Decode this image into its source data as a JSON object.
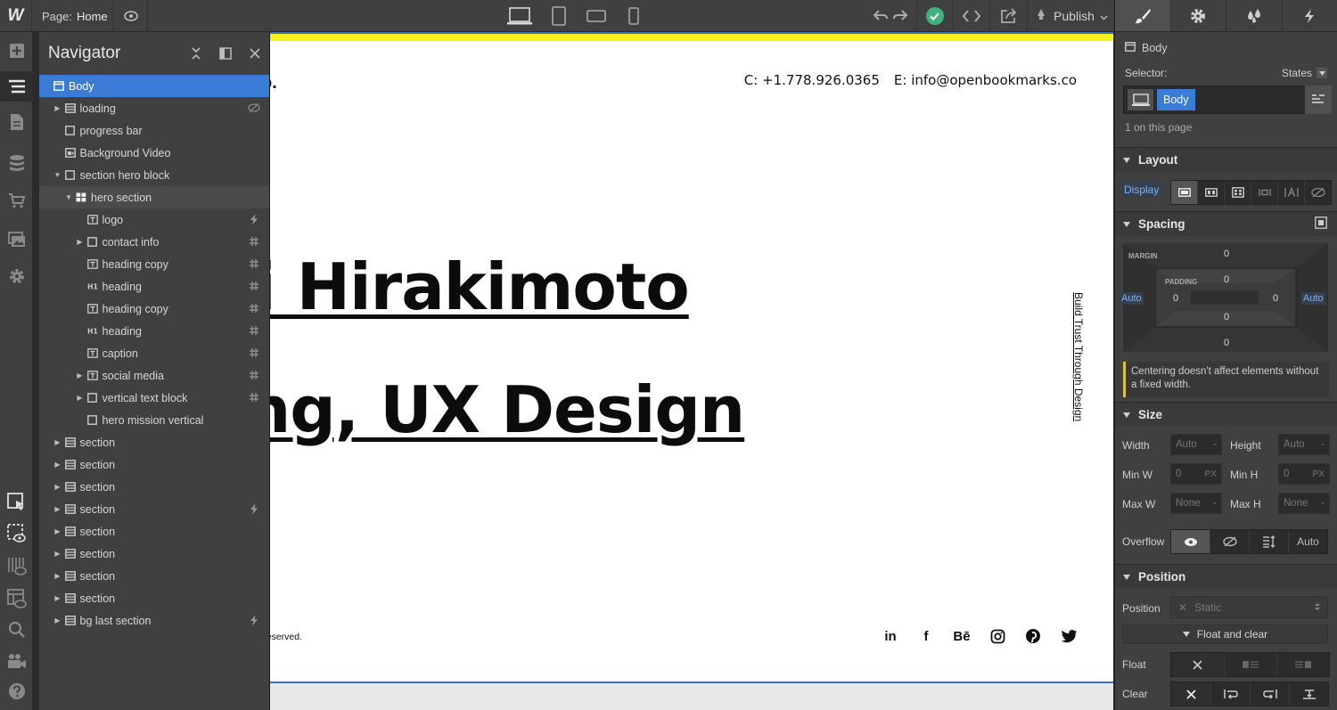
{
  "topbar": {
    "logo": "W",
    "page_label": "Page:",
    "page_name": "Home",
    "publish_label": "Publish"
  },
  "navigator": {
    "title": "Navigator",
    "items": [
      {
        "label": "Body",
        "depth": 0,
        "caret": "",
        "icon": "body",
        "right": "",
        "selected": true
      },
      {
        "label": "loading",
        "depth": 1,
        "caret": "right",
        "icon": "section",
        "right": "hidden"
      },
      {
        "label": "progress bar",
        "depth": 1,
        "caret": "",
        "icon": "div",
        "right": ""
      },
      {
        "label": "Background Video",
        "depth": 1,
        "caret": "",
        "icon": "video",
        "right": ""
      },
      {
        "label": "section hero block",
        "depth": 1,
        "caret": "down",
        "icon": "div",
        "right": ""
      },
      {
        "label": "hero section",
        "depth": 2,
        "caret": "down",
        "icon": "grid",
        "right": "",
        "hover": true
      },
      {
        "label": "logo",
        "depth": 3,
        "caret": "",
        "icon": "text",
        "right": "bolt"
      },
      {
        "label": "contact info",
        "depth": 3,
        "caret": "right",
        "icon": "div",
        "right": "hash"
      },
      {
        "label": "heading copy",
        "depth": 3,
        "caret": "",
        "icon": "text",
        "right": "hash"
      },
      {
        "label": "heading",
        "depth": 3,
        "caret": "",
        "icon": "h1",
        "right": "hash"
      },
      {
        "label": "heading copy",
        "depth": 3,
        "caret": "",
        "icon": "text",
        "right": "hash"
      },
      {
        "label": "heading",
        "depth": 3,
        "caret": "",
        "icon": "h1",
        "right": "hash"
      },
      {
        "label": "caption",
        "depth": 3,
        "caret": "",
        "icon": "text",
        "right": "hash"
      },
      {
        "label": "social media",
        "depth": 3,
        "caret": "right",
        "icon": "text",
        "right": "hash"
      },
      {
        "label": "vertical text block",
        "depth": 3,
        "caret": "right",
        "icon": "div",
        "right": "hash"
      },
      {
        "label": "hero mission vertical",
        "depth": 3,
        "caret": "",
        "icon": "div",
        "right": ""
      },
      {
        "label": "section",
        "depth": 1,
        "caret": "right",
        "icon": "section",
        "right": ""
      },
      {
        "label": "section",
        "depth": 1,
        "caret": "right",
        "icon": "section",
        "right": ""
      },
      {
        "label": "section",
        "depth": 1,
        "caret": "right",
        "icon": "section",
        "right": ""
      },
      {
        "label": "section",
        "depth": 1,
        "caret": "right",
        "icon": "section",
        "right": "bolt"
      },
      {
        "label": "section",
        "depth": 1,
        "caret": "right",
        "icon": "section",
        "right": ""
      },
      {
        "label": "section",
        "depth": 1,
        "caret": "right",
        "icon": "section",
        "right": ""
      },
      {
        "label": "section",
        "depth": 1,
        "caret": "right",
        "icon": "section",
        "right": ""
      },
      {
        "label": "section",
        "depth": 1,
        "caret": "right",
        "icon": "section",
        "right": ""
      },
      {
        "label": "bg last section",
        "depth": 1,
        "caret": "right",
        "icon": "section",
        "right": "bolt"
      }
    ]
  },
  "canvas": {
    "logo_fragment": "o.",
    "contact_phone": "C: +1.778.926.0365",
    "contact_email": "E: info@openbookmarks.co",
    "heading_line1": "i Hirakimoto",
    "heading_line2": "ng, UX Design",
    "vertical_text": "Build Trust Through Design",
    "rights": "s Reserved.",
    "social": [
      "in",
      "f",
      "Bē",
      "instagram-icon",
      "pinterest-icon",
      "twitter-icon"
    ]
  },
  "style_panel": {
    "element": "Body",
    "selector_label": "Selector:",
    "states_label": "States",
    "selector_chip": "Body",
    "on_page": "1 on this page",
    "layout_title": "Layout",
    "display_label": "Display",
    "spacing_title": "Spacing",
    "margin_label": "MARGIN",
    "padding_label": "PADDING",
    "margin": {
      "top": "0",
      "right": "Auto",
      "bottom": "0",
      "left": "Auto"
    },
    "padding": {
      "top": "0",
      "right": "0",
      "bottom": "0",
      "left": "0"
    },
    "note": "Centering doesn't affect elements without a fixed width.",
    "size_title": "Size",
    "width_label": "Width",
    "width_value": "Auto",
    "height_label": "Height",
    "height_value": "Auto",
    "minw_label": "Min W",
    "minw_value": "0",
    "minw_unit": "PX",
    "minh_label": "Min H",
    "minh_value": "0",
    "minh_unit": "PX",
    "maxw_label": "Max W",
    "maxw_value": "None",
    "maxh_label": "Max H",
    "maxh_value": "None",
    "overflow_label": "Overflow",
    "overflow_auto": "Auto",
    "position_title": "Position",
    "position_label": "Position",
    "position_value": "Static",
    "float_clear_label": "Float and clear",
    "float_label": "Float",
    "clear_label": "Clear",
    "accent": "#3a7bd5"
  }
}
